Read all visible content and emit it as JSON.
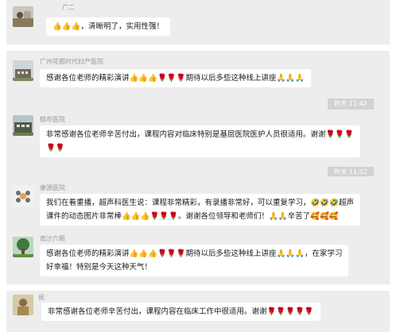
{
  "messages": [
    {
      "sender": "广二",
      "avatar_icon": "landscape-avatar-icon",
      "lines": [
        "👍👍👍，清晰明了，实用性强！"
      ]
    },
    {
      "sender": "广州花都时代妇产医院",
      "avatar_icon": "building-avatar-icon",
      "lines": [
        "感谢各位老师的精彩演讲👍👍👍🌹🌹🌹期待以后多些这种线上讲座🙏🙏🙏"
      ],
      "timestamp": "昨天 11:42"
    },
    {
      "sender": "郁市医院",
      "avatar_icon": "building-avatar-icon",
      "lines": [
        "非常感谢各位老师辛苦付出，课程内容对临床特别是基层医院医护人员很适用。谢谢🌹🌹🌹",
        "🌹🌹"
      ],
      "timestamp": "昨天 11:52"
    },
    {
      "sender": "康源医院",
      "avatar_icon": "flower-avatar-icon",
      "lines": [
        "我们在看重播，超声科医生说：课程非常精彩，有录播非常好，可以重复学习，🤣🤣🤣超声",
        "课件的动态图片非常棒👍👍👍🌹🌹🌹。谢谢各位领导和老师们！🙏🙏辛苦了🥰🥰🥰"
      ]
    },
    {
      "sender": "南沙六颗",
      "avatar_icon": "tree-avatar-icon",
      "lines": [
        "感谢各位老师的精彩演讲👍👍👍🌹🌹🌹期待以后多些这种线上讲座🙏🙏🙏，在家学习",
        "好幸福！特别是今天这种天气！"
      ]
    },
    {
      "sender": "侯",
      "avatar_icon": "photo-avatar-icon",
      "lines": [
        "非常感谢各位老师辛苦付出，课程内容在临床工作中很适用。谢谢🌹🌹🌹🌹🌹"
      ]
    }
  ],
  "colors": {
    "block_background": "#ededed",
    "bubble_background": "#ffffff",
    "timestamp_background": "#d2d2d2",
    "sender_text": "#9a9a9a"
  }
}
